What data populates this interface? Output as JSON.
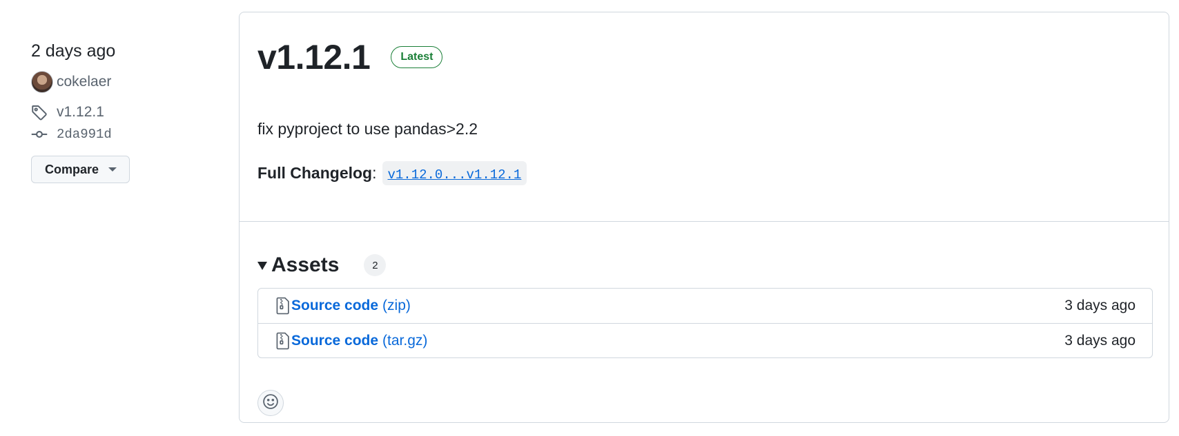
{
  "meta": {
    "date": "2 days ago",
    "author": "cokelaer",
    "tag": "v1.12.1",
    "commit": "2da991d",
    "compare_label": "Compare"
  },
  "release": {
    "title": "v1.12.1",
    "badge": "Latest",
    "description": "fix pyproject to use pandas>2.2",
    "changelog_label": "Full Changelog",
    "changelog_sep": ":",
    "changelog_link": "v1.12.0...v1.12.1"
  },
  "assets": {
    "title": "Assets",
    "count": "2",
    "items": [
      {
        "name": "Source code",
        "ext": "(zip)",
        "time": "3 days ago"
      },
      {
        "name": "Source code",
        "ext": "(tar.gz)",
        "time": "3 days ago"
      }
    ]
  },
  "icons": {
    "tag": "tag-icon",
    "commit": "git-commit-icon",
    "caret": "triangle-down-icon",
    "file": "file-zip-icon",
    "smiley": "smiley-icon"
  },
  "colors": {
    "link": "#0969da",
    "latest": "#1a7f37",
    "border": "#d0d7de"
  }
}
